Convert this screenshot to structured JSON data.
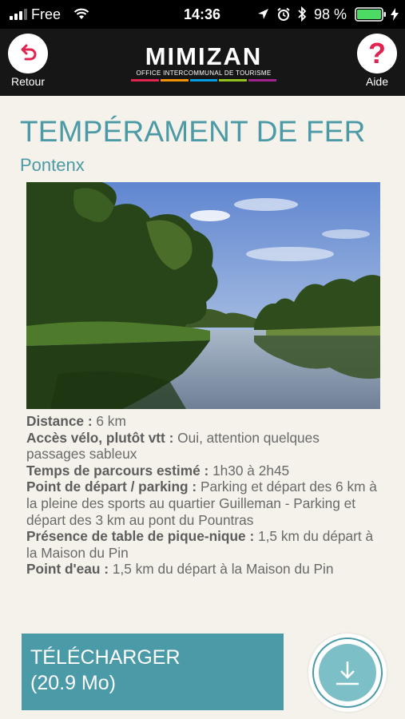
{
  "status": {
    "carrier": "Free",
    "time": "14:36",
    "battery": "98 %"
  },
  "header": {
    "back_label": "Retour",
    "help_label": "Aide",
    "logo_name": "MIMIZAN",
    "logo_sub": "OFFICE INTERCOMMUNAL DE TOURISME",
    "accent": "#e0244f",
    "help_glyph": "?"
  },
  "page": {
    "title": "TEMPÉRAMENT DE FER",
    "location": "Pontenx"
  },
  "details": [
    {
      "label": "Distance :",
      "value": " 6 km"
    },
    {
      "label": "Accès vélo, plutôt vtt :",
      "value": " Oui, attention quelques passages sableux"
    },
    {
      "label": "Temps de parcours estimé :",
      "value": " 1h30 à 2h45"
    },
    {
      "label": "Point de départ / parking :",
      "value": " Parking et départ des 6 km à la pleine des sports au quartier Guilleman - Parking et départ des 3 km au pont du Pountras"
    },
    {
      "label": "Présence de table de pique-nique :",
      "value": " 1,5 km du départ à la Maison du Pin"
    },
    {
      "label": "Point d'eau :",
      "value": " 1,5 km du départ à la Maison du Pin"
    }
  ],
  "download": {
    "label": "TÉLÉCHARGER",
    "size": "(20.9 Mo)",
    "color": "#4a9aa8"
  }
}
